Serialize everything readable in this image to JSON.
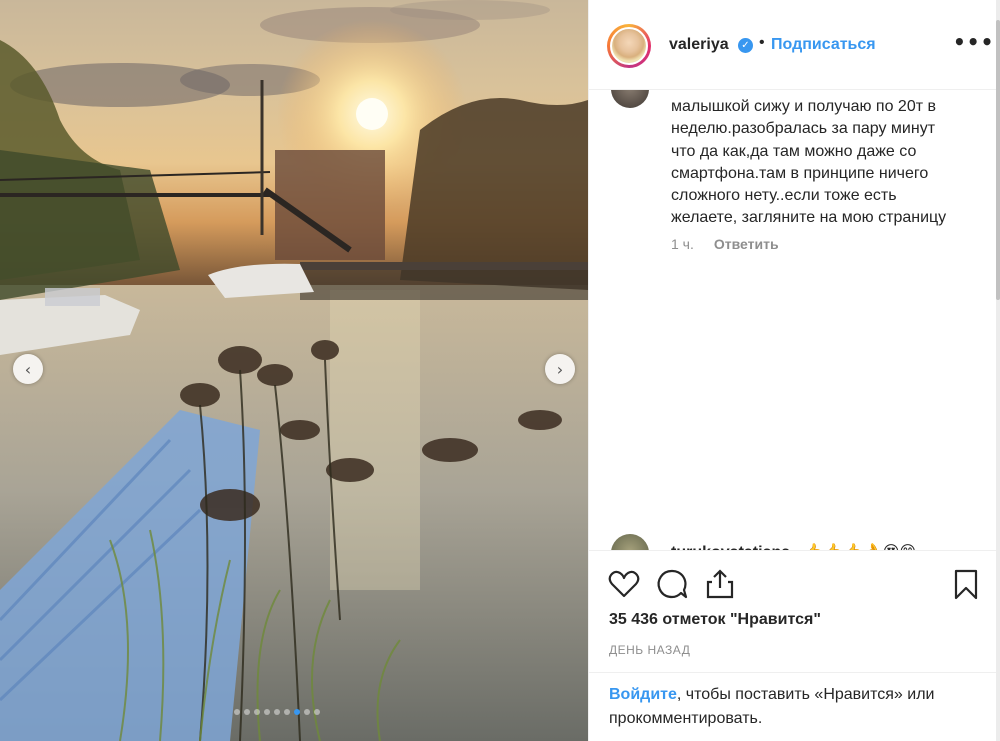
{
  "photo": {
    "description_alt": "",
    "carousel": {
      "prev": "‹",
      "next": "›",
      "total_slides": 9,
      "active_slide": 7
    }
  },
  "header": {
    "username": "valeriya",
    "verified_icon": "verified-badge-icon",
    "separator": "•",
    "follow_label": "Подписаться",
    "more_label": "•••"
  },
  "comments": [
    {
      "text": "малышкой сижу и получаю по 20т в\nнеделю.разобралась за пару минут\nчто да как,да там можно даже со\nсмартфона.там в принципе ничего\nсложного нету..если тоже есть\nжелаете, загляните на мою страницу",
      "time": "1 ч.",
      "reply_label": "Ответить"
    },
    {
      "username": "turukovatatiana",
      "text": "👍👍👍👌😍😁"
    }
  ],
  "actions": {
    "like_icon": "heart-icon",
    "comment_icon": "comment-icon",
    "share_icon": "share-icon",
    "save_icon": "bookmark-icon",
    "likes_text": "35 436 отметок \"Нравится\"",
    "time_ago": "ДЕНЬ НАЗАД"
  },
  "login": {
    "link_label": "Войдите",
    "rest_text": ", чтобы поставить «Нравится» или прокомментировать."
  },
  "colors": {
    "accent": "#3897f0",
    "text": "#262626",
    "muted": "#8e8e8e",
    "border": "#efefef"
  }
}
